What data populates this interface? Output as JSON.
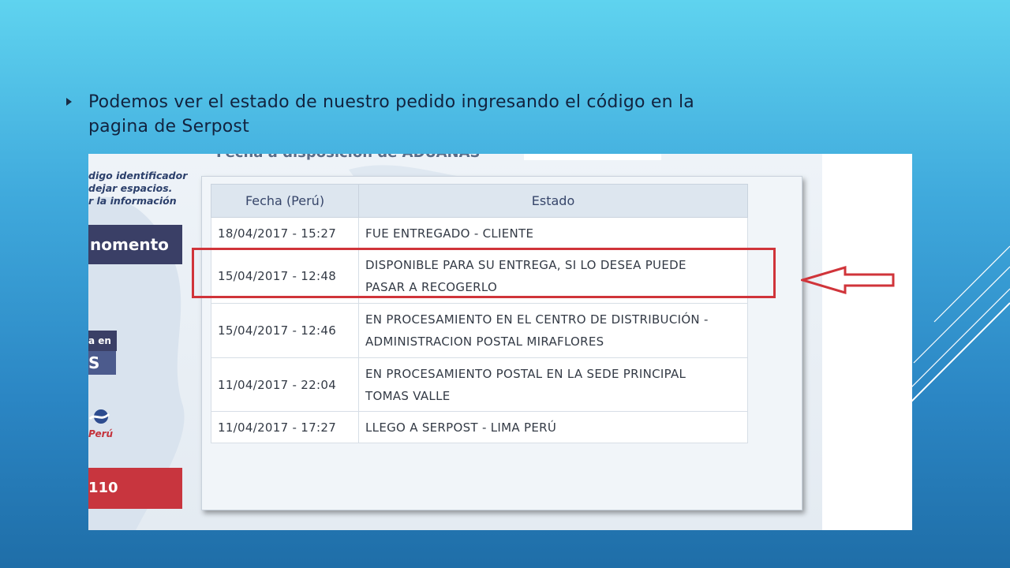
{
  "slide": {
    "bullet_line1": "Podemos ver el estado de nuestro pedido ingresando el código en la",
    "bullet_line2": "pagina de Serpost"
  },
  "screenshot": {
    "top_label": "Fecha a disposición de ADUANAS",
    "side_hint": [
      "digo identificador",
      "dejar espacios.",
      "r la información"
    ],
    "side_button_momento": "nomento",
    "side_box_en": "a en",
    "side_box_s": "S",
    "side_logo_text": "Perú",
    "side_button_110": "110",
    "table": {
      "headers": [
        "Fecha (Perú)",
        "Estado"
      ],
      "rows": [
        {
          "fecha": "18/04/2017 - 15:27",
          "estado": [
            "FUE ENTREGADO - CLIENTE"
          ]
        },
        {
          "fecha": "15/04/2017 - 12:48",
          "estado": [
            "DISPONIBLE PARA SU ENTREGA, SI LO DESEA PUEDE",
            "PASAR A RECOGERLO"
          ]
        },
        {
          "fecha": "15/04/2017 - 12:46",
          "estado": [
            "EN PROCESAMIENTO EN EL CENTRO DE DISTRIBUCIÓN -",
            "ADMINISTRACION POSTAL MIRAFLORES"
          ]
        },
        {
          "fecha": "11/04/2017 - 22:04",
          "estado": [
            "EN PROCESAMIENTO POSTAL EN LA SEDE PRINCIPAL",
            "TOMAS VALLE"
          ]
        },
        {
          "fecha": "11/04/2017 - 17:27",
          "estado": [
            "LLEGO A SERPOST - LIMA PERÚ"
          ]
        }
      ]
    }
  },
  "colors": {
    "highlight": "#d0343a",
    "side_dark": "#3a3f66",
    "side_red": "#c8353e"
  }
}
